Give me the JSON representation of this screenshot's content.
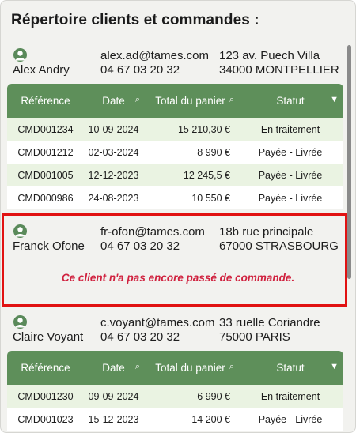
{
  "page_title": "Répertoire clients et commandes :",
  "columns": {
    "reference": "Référence",
    "date": "Date",
    "total": "Total du panier",
    "status": "Statut"
  },
  "clients": [
    {
      "name": "Alex Andry",
      "email": "alex.ad@tames.com",
      "phone": "04 67 03 20 32",
      "address_line1": "123 av. Puech Villa",
      "address_line2": "34000 MONTPELLIER",
      "orders": [
        {
          "ref": "CMD001234",
          "date": "10-09-2024",
          "total": "15 210,30 €",
          "status": "En traitement"
        },
        {
          "ref": "CMD001212",
          "date": "02-03-2024",
          "total": "8 990 €",
          "status": "Payée - Livrée"
        },
        {
          "ref": "CMD001005",
          "date": "12-12-2023",
          "total": "12 245,5 €",
          "status": "Payée - Livrée"
        },
        {
          "ref": "CMD000986",
          "date": "24-08-2023",
          "total": "10 550 €",
          "status": "Payée - Livrée"
        }
      ]
    },
    {
      "name": "Franck Ofone",
      "email": "fr-ofon@tames.com",
      "phone": "04 67 03 20 32",
      "address_line1": "18b rue principale",
      "address_line2": "67000 STRASBOURG",
      "empty_message": "Ce client n'a pas encore passé de commande."
    },
    {
      "name": "Claire Voyant",
      "email": "c.voyant@tames.com",
      "phone": "04 67 03 20 32",
      "address_line1": "33 ruelle Coriandre",
      "address_line2": "75000 PARIS",
      "orders": [
        {
          "ref": "CMD001230",
          "date": "09-09-2024",
          "total": "6 990 €",
          "status": "En traitement"
        },
        {
          "ref": "CMD001023",
          "date": "15-12-2023",
          "total": "14 200 €",
          "status": "Payée - Livrée"
        }
      ]
    }
  ],
  "colors": {
    "header_green": "#5e8f5a",
    "row_green": "#eaf3e2",
    "highlight_red": "#e11212",
    "message_red": "#d0223f"
  },
  "icons": {
    "avatar": "user-avatar-icon",
    "search": "search-icon",
    "filter": "filter-icon"
  }
}
